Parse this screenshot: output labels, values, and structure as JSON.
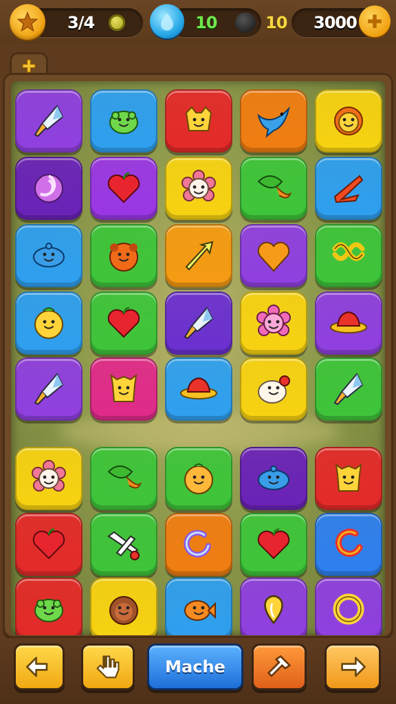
{
  "hud": {
    "stars": "3/4",
    "gems_left": "10",
    "gems_right": "10",
    "coins": "3000"
  },
  "board": {
    "rows": [
      [
        {
          "color": "#8f3fe0",
          "icon": "kite-icon"
        },
        {
          "color": "#2e9ff0",
          "icon": "green-blob-icon"
        },
        {
          "color": "#e42a2a",
          "icon": "yellow-critter-icon"
        },
        {
          "color": "#f07d12",
          "icon": "blue-bird-icon"
        },
        {
          "color": "#f7d212",
          "icon": "lion-icon"
        }
      ],
      [
        {
          "color": "#6a22b8",
          "icon": "shell-icon"
        },
        {
          "color": "#9a36e6",
          "icon": "heart-icon"
        },
        {
          "color": "#f7d212",
          "icon": "flower-icon"
        },
        {
          "color": "#3ec43a",
          "icon": "leaf-icon"
        },
        {
          "color": "#2e9ff0",
          "icon": "boomerang-icon"
        }
      ],
      [
        {
          "color": "#2e9ff0",
          "icon": "blue-fish-icon"
        },
        {
          "color": "#3ec43a",
          "icon": "orange-lion-icon"
        },
        {
          "color": "#f59a12",
          "icon": "arrow-icon"
        },
        {
          "color": "#8f3fe0",
          "icon": "orange-heart-icon"
        },
        {
          "color": "#3ec43a",
          "icon": "pretzel-icon"
        }
      ],
      [
        {
          "color": "#2e9ff0",
          "icon": "sun-blob-icon"
        },
        {
          "color": "#3ec43a",
          "icon": "heart-icon"
        },
        {
          "color": "#6a2fd0",
          "icon": "kite-icon"
        },
        {
          "color": "#f7d212",
          "icon": "pink-flower-icon"
        },
        {
          "color": "#8f3fe0",
          "icon": "hat-icon"
        }
      ],
      [
        {
          "color": "#8f3fe0",
          "icon": "kite-icon"
        },
        {
          "color": "#e02a8a",
          "icon": "giraffe-icon"
        },
        {
          "color": "#2e9ff0",
          "icon": "hat-icon"
        },
        {
          "color": "#f7d212",
          "icon": "bunny-icon"
        },
        {
          "color": "#3ec43a",
          "icon": "kite-icon"
        }
      ],
      [
        {
          "color": "#f7d212",
          "icon": "flower-icon"
        },
        {
          "color": "#3ec43a",
          "icon": "leaf-icon"
        },
        {
          "color": "#3ec43a",
          "icon": "orange-blob-icon"
        },
        {
          "color": "#6a22b8",
          "icon": "blue-fish-icon"
        },
        {
          "color": "#e42a2a",
          "icon": "giraffe-icon"
        }
      ],
      [
        {
          "color": "#e42a2a",
          "icon": "heart-icon"
        },
        {
          "color": "#3ec43a",
          "icon": "plane-icon"
        },
        {
          "color": "#f07d12",
          "icon": "swirl-icon"
        },
        {
          "color": "#3ec43a",
          "icon": "heart-icon"
        },
        {
          "color": "#2e7ff0",
          "icon": "red-swirl-icon"
        }
      ],
      [
        {
          "color": "#e42a2a",
          "icon": "green-blob-icon"
        },
        {
          "color": "#f7d212",
          "icon": "brown-lion-icon"
        },
        {
          "color": "#2e9ff0",
          "icon": "orange-fish-icon"
        },
        {
          "color": "#8f3fe0",
          "icon": "drop-icon"
        },
        {
          "color": "#8f3fe0",
          "icon": "ring-icon"
        }
      ]
    ]
  },
  "bottom_bar": {
    "back_icon": "undo-arrow-icon",
    "hint_icon": "hand-icon",
    "match_label": "Mache",
    "tool_icon": "hammer-icon",
    "next_icon": "right-arrow-icon"
  }
}
